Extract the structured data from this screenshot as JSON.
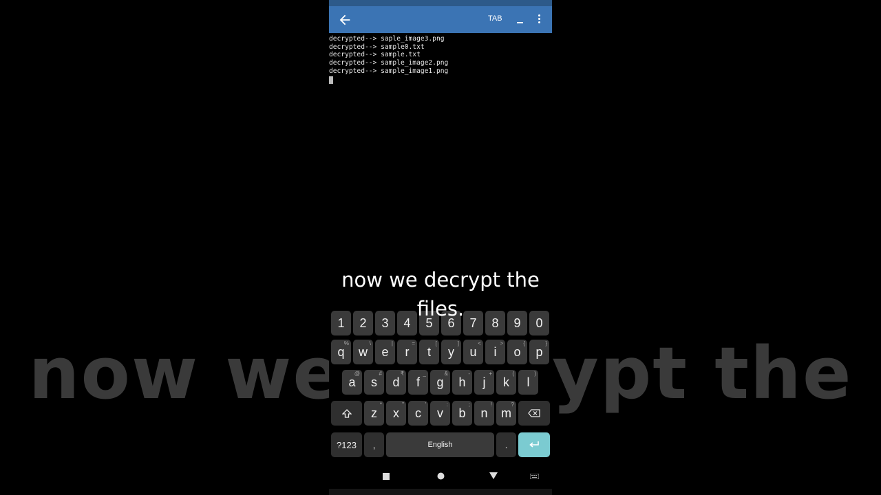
{
  "background_caption": "now we decrypt the",
  "toolbar": {
    "tab_label": "TAB"
  },
  "terminal": {
    "lines": [
      "decrypted--> saple_image3.png",
      "decrypted--> sample0.txt",
      "decrypted--> sample.txt",
      "decrypted--> sample_image2.png",
      "decrypted--> sample_image1.png"
    ]
  },
  "caption": "now we decrypt the files.",
  "keyboard": {
    "number_row": [
      "1",
      "2",
      "3",
      "4",
      "5",
      "6",
      "7",
      "8",
      "9",
      "0"
    ],
    "row1": [
      {
        "k": "q",
        "h": "%"
      },
      {
        "k": "w",
        "h": "\\"
      },
      {
        "k": "e",
        "h": "|"
      },
      {
        "k": "r",
        "h": "="
      },
      {
        "k": "t",
        "h": "["
      },
      {
        "k": "y",
        "h": "]"
      },
      {
        "k": "u",
        "h": "<"
      },
      {
        "k": "i",
        "h": ">"
      },
      {
        "k": "o",
        "h": "{"
      },
      {
        "k": "p",
        "h": "}"
      }
    ],
    "row2": [
      {
        "k": "a",
        "h": "@"
      },
      {
        "k": "s",
        "h": "#"
      },
      {
        "k": "d",
        "h": "₹"
      },
      {
        "k": "f",
        "h": "_"
      },
      {
        "k": "g",
        "h": "&"
      },
      {
        "k": "h",
        "h": "-"
      },
      {
        "k": "j",
        "h": "+"
      },
      {
        "k": "k",
        "h": "("
      },
      {
        "k": "l",
        "h": ")"
      }
    ],
    "row3": [
      {
        "k": "z",
        "h": "*"
      },
      {
        "k": "x",
        "h": "\""
      },
      {
        "k": "c",
        "h": "'"
      },
      {
        "k": "v",
        "h": ":"
      },
      {
        "k": "b",
        "h": ";"
      },
      {
        "k": "n",
        "h": "!"
      },
      {
        "k": "m",
        "h": "?"
      }
    ],
    "symbols_label": "?123",
    "comma": ",",
    "space_label": "English",
    "period": ".",
    "colors": {
      "key": "#3a3a3a",
      "enter": "#7bcbd1",
      "toolbar": "#3b74b4"
    }
  }
}
